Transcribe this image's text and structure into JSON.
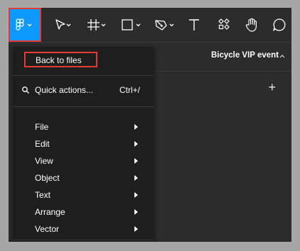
{
  "toolbar": {
    "tools": [
      {
        "icon": "figma-logo-icon",
        "has_dropdown": true
      },
      {
        "icon": "move-tool-icon",
        "has_dropdown": true
      },
      {
        "icon": "frame-tool-icon",
        "has_dropdown": true
      },
      {
        "icon": "shape-tool-icon",
        "has_dropdown": true
      },
      {
        "icon": "pen-tool-icon",
        "has_dropdown": true
      },
      {
        "icon": "text-tool-icon",
        "has_dropdown": false
      },
      {
        "icon": "components-icon",
        "has_dropdown": false
      },
      {
        "icon": "hand-tool-icon",
        "has_dropdown": false
      },
      {
        "icon": "comment-tool-icon",
        "has_dropdown": false
      }
    ]
  },
  "file": {
    "name": "Bicycle VIP event"
  },
  "menu": {
    "back_to_files": "Back to files",
    "quick_actions": {
      "label": "Quick actions...",
      "shortcut": "Ctrl+/"
    },
    "items": [
      {
        "label": "File"
      },
      {
        "label": "Edit"
      },
      {
        "label": "View"
      },
      {
        "label": "Object"
      },
      {
        "label": "Text"
      },
      {
        "label": "Arrange"
      },
      {
        "label": "Vector"
      }
    ]
  },
  "colors": {
    "accent": "#0d99ff",
    "highlight_box": "#e53935",
    "toolbar_bg": "#2c2c2c",
    "menu_bg": "#1e1e1e"
  }
}
